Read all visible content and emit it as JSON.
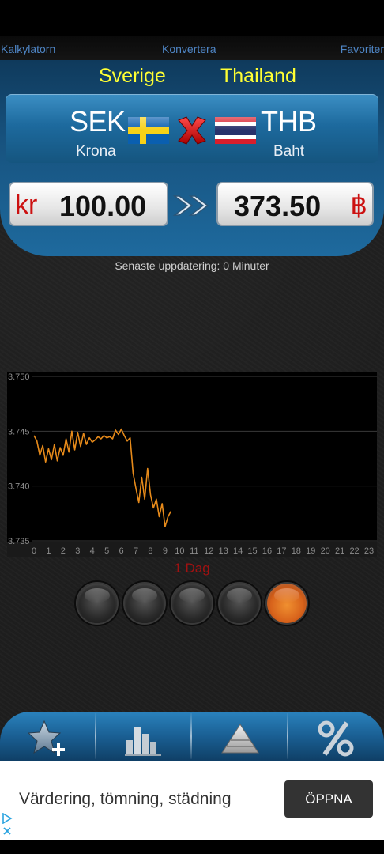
{
  "nav": {
    "left": "Kalkylatorn",
    "center": "Konvertera",
    "right": "Favoriter"
  },
  "pair": {
    "from_country": "Sverige",
    "to_country": "Thailand",
    "from_code": "SEK",
    "to_code": "THB",
    "from_name": "Krona",
    "to_name": "Baht",
    "from_symbol": "kr",
    "to_symbol": "฿",
    "from_amount": "100.00",
    "to_amount": "373.50"
  },
  "update_text": "Senaste uppdatering: 0 Minuter",
  "period_label": "1 Dag",
  "range_buttons": {
    "count": 5,
    "active_index": 4
  },
  "colors": {
    "accent_blue": "#1d6a9e",
    "country_yellow": "#ffff33",
    "symbol_red": "#cc1111",
    "line_orange": "#e68a1a",
    "period_red": "#a11111",
    "active_range": "#d7621b"
  },
  "bottom_tabs": [
    {
      "icon": "star-plus-icon"
    },
    {
      "icon": "bar-chart-icon"
    },
    {
      "icon": "pyramid-icon"
    },
    {
      "icon": "percent-icon"
    }
  ],
  "ad": {
    "text": "Värdering, tömning, städning",
    "button": "ÖPPNA"
  },
  "chart_data": {
    "type": "line",
    "title": "",
    "xlabel": "",
    "ylabel": "",
    "x_ticks": [
      "0",
      "1",
      "2",
      "3",
      "4",
      "5",
      "6",
      "7",
      "8",
      "9",
      "10",
      "11",
      "12",
      "13",
      "14",
      "15",
      "16",
      "17",
      "18",
      "19",
      "20",
      "21",
      "22",
      "23"
    ],
    "y_ticks": [
      "3.750",
      "3.745",
      "3.740",
      "3.735"
    ],
    "xlim": [
      0,
      23
    ],
    "ylim": [
      3.735,
      3.75
    ],
    "grid": true,
    "series": [
      {
        "x": [
          0,
          0.2,
          0.4,
          0.6,
          0.8,
          1.0,
          1.2,
          1.4,
          1.6,
          1.8,
          2.0,
          2.2,
          2.4,
          2.6,
          2.8,
          3.0,
          3.2,
          3.4,
          3.6,
          3.8,
          4.0,
          4.2,
          4.4,
          4.6,
          4.8,
          5.0,
          5.2,
          5.4,
          5.6,
          5.8,
          6.0,
          6.2,
          6.4,
          6.6,
          6.8,
          7.0,
          7.2,
          7.4,
          7.6,
          7.8,
          8.0,
          8.2,
          8.4,
          8.6,
          8.8,
          9.0,
          9.2,
          9.4
        ],
        "values": [
          3.7446,
          3.7441,
          3.7428,
          3.7437,
          3.7422,
          3.7434,
          3.7424,
          3.7438,
          3.7423,
          3.7435,
          3.7428,
          3.7443,
          3.7431,
          3.745,
          3.7433,
          3.7449,
          3.7436,
          3.7448,
          3.7438,
          3.7444,
          3.744,
          3.7442,
          3.7445,
          3.7443,
          3.7446,
          3.7444,
          3.7445,
          3.7443,
          3.7451,
          3.7447,
          3.7452,
          3.7446,
          3.7441,
          3.7444,
          3.7412,
          3.7398,
          3.7385,
          3.7408,
          3.7388,
          3.7416,
          3.7392,
          3.738,
          3.7388,
          3.7372,
          3.7384,
          3.7363,
          3.7372,
          3.7377
        ]
      }
    ]
  }
}
